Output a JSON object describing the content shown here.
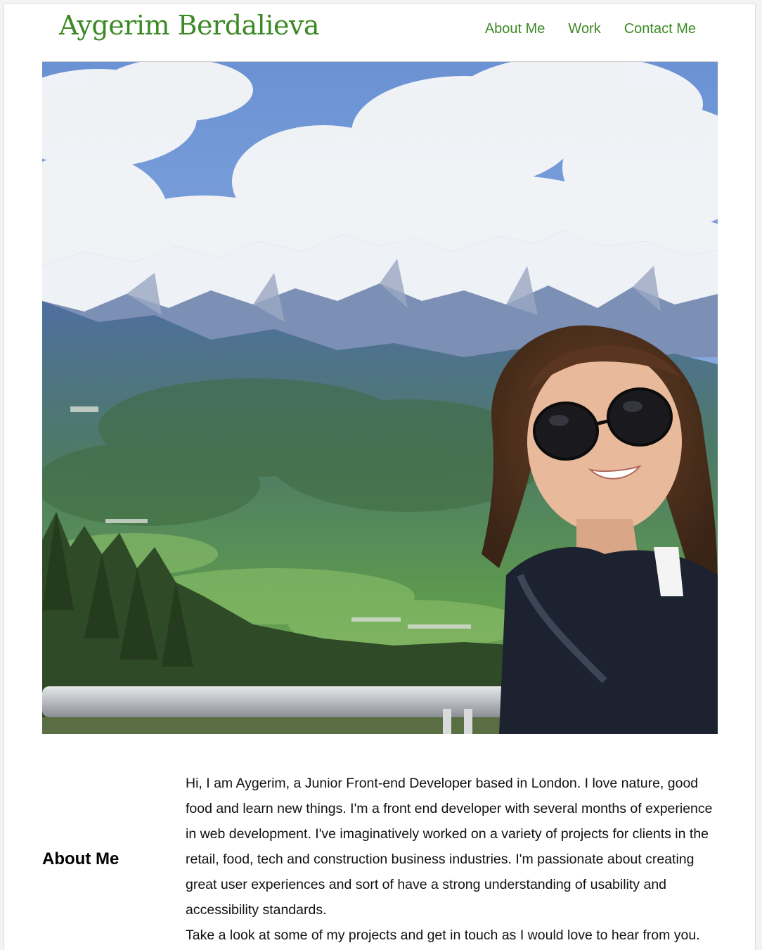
{
  "header": {
    "brand": "Aygerim Berdalieva",
    "nav": [
      {
        "label": "About Me"
      },
      {
        "label": "Work"
      },
      {
        "label": "Contact Me"
      }
    ]
  },
  "hero": {
    "description": "photo-of-person-with-sunglasses-in-front-of-snowy-mountains"
  },
  "about": {
    "heading": "About Me",
    "paragraph1": "Hi, I am Aygerim, a Junior Front-end Developer based in London. I love nature, good food and learn new things. I'm a front end developer with several months of experience in web development. I've imaginatively worked on a variety of projects for clients in the retail, food, tech and construction business industries. I'm passionate about creating great user experiences and sort of have a strong understanding of usability and accessibility standards.",
    "paragraph2": "Take a look at some of my projects and get in touch as I would love to hear from you."
  },
  "colors": {
    "brand_green": "#3c8a25",
    "text": "#111111",
    "background": "#ffffff"
  }
}
